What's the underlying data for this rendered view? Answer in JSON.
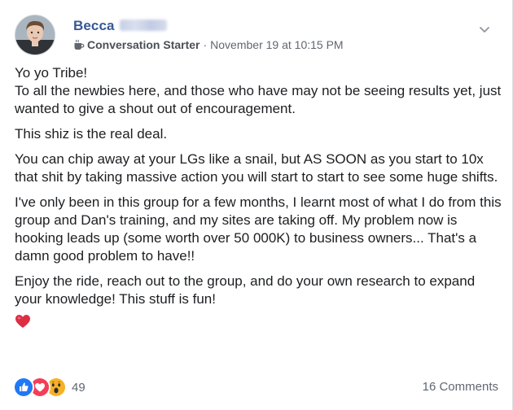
{
  "post": {
    "author_name": "Becca",
    "badge_label": "Conversation Starter",
    "separator": "·",
    "timestamp": "November 19 at 10:15 PM",
    "paragraphs": [
      "Yo yo Tribe!\nTo all the newbies here, and those who have may not be seeing results yet, just wanted to give a shout out of encouragement.",
      "This shiz is the real deal.",
      "You can chip away at your LGs like a snail, but AS SOON as you start to 10x that shit by taking massive action you will start to start to see some huge shifts.",
      "I've only been in this group for a few months, I learnt most of what I do from this group and Dan's training, and my sites are taking off. My problem now is hooking leads up (some worth over 50 000K) to business owners... That's a damn good problem to have!!",
      "Enjoy the ride, reach out to the group, and do your own research to expand your knowledge! This stuff is fun!"
    ],
    "closing_emoji": "red-heart-icon"
  },
  "reactions": {
    "types": [
      "like-icon",
      "love-icon",
      "wow-icon"
    ],
    "count": "49"
  },
  "comments_label": "16 Comments",
  "colors": {
    "author": "#385898",
    "meta": "#616770",
    "text": "#1c1e21",
    "like": "#2078f4",
    "love": "#f33e58",
    "wow": "#f7b125"
  }
}
